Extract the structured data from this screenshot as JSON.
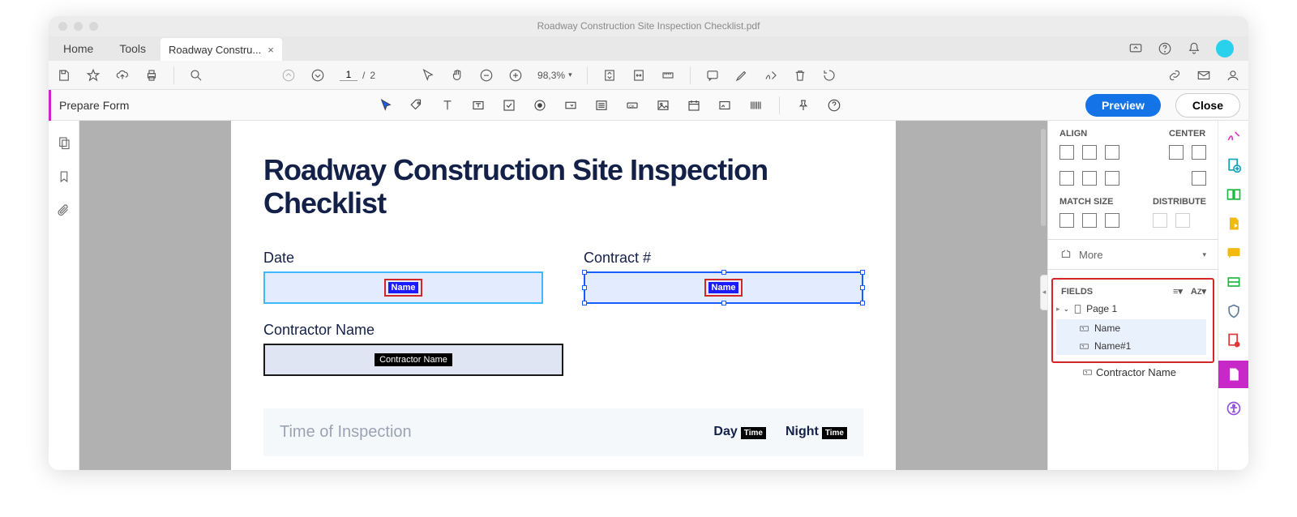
{
  "window": {
    "title": "Roadway Construction Site Inspection Checklist.pdf"
  },
  "tabs": {
    "home": "Home",
    "tools": "Tools",
    "file": "Roadway Constru...",
    "close_glyph": "×"
  },
  "toolbar": {
    "page_current": "1",
    "page_sep": "/",
    "page_total": "2",
    "zoom": "98,3%",
    "zoom_caret": "▾"
  },
  "formbar": {
    "title": "Prepare Form",
    "preview": "Preview",
    "close": "Close"
  },
  "document": {
    "heading": "Roadway Construction Site Inspection Checklist",
    "labels": {
      "date": "Date",
      "contract": "Contract #",
      "contractor": "Contractor Name"
    },
    "field_names": {
      "date": "Name",
      "contract": "Name",
      "contractor": "Contractor Name"
    },
    "footer": {
      "title": "Time of Inspection",
      "day": "Day",
      "night": "Night",
      "time": "Time"
    }
  },
  "right": {
    "align": "ALIGN",
    "center": "CENTER",
    "match": "MATCH SIZE",
    "distribute": "DISTRIBUTE",
    "more": "More",
    "fields": "FIELDS",
    "tree": {
      "page": "Page 1",
      "f1": "Name",
      "f2": "Name#1",
      "f3": "Contractor Name"
    },
    "glyphs": {
      "caret": "▾",
      "sort": "≡",
      "az": "A̲Z",
      "arrow_right": "▸",
      "arrow_left": "◂"
    }
  }
}
